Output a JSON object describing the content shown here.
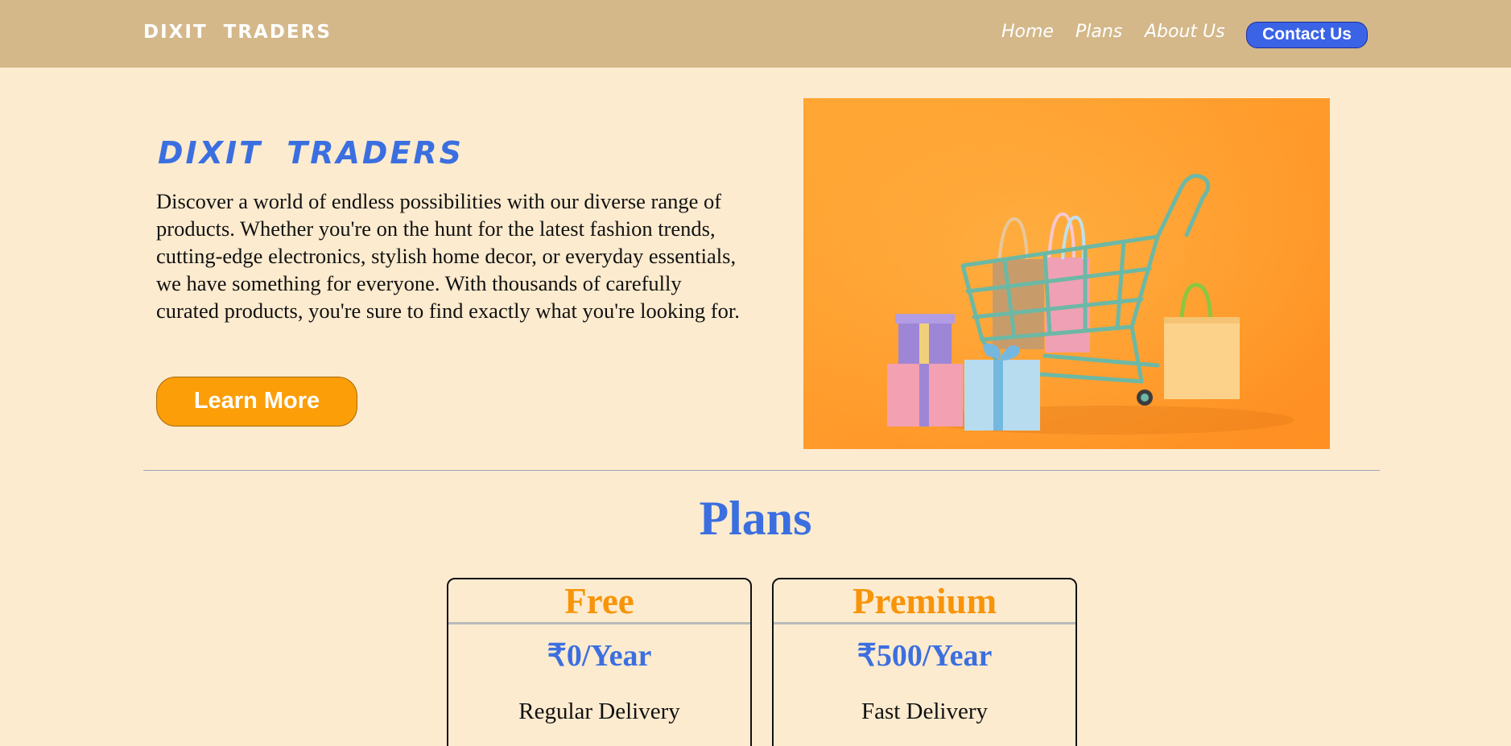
{
  "navbar": {
    "brand": "DIXIT TRADERS",
    "links": [
      "Home",
      "Plans",
      "About Us"
    ],
    "contact_label": "Contact Us"
  },
  "hero": {
    "title": "DIXIT TRADERS",
    "description": "Discover a world of endless possibilities with our diverse range of products. Whether you're on the hunt for the latest fashion trends, cutting-edge electronics, stylish home decor, or everyday essentials, we have something for everyone. With thousands of carefully curated products, you're sure to find exactly what you're looking for.",
    "button_label": "Learn More",
    "image_icon": "shopping-cart-gifts-image"
  },
  "plans": {
    "heading": "Plans",
    "cards": [
      {
        "name": "Free",
        "price": "₹0/Year",
        "feature": "Regular Delivery"
      },
      {
        "name": "Premium",
        "price": "₹500/Year",
        "feature": "Fast Delivery"
      }
    ]
  },
  "colors": {
    "page_bg": "#fdebcf",
    "navbar_bg": "#d4b88a",
    "accent_blue": "#3b6fe0",
    "accent_orange": "#fb9e08",
    "image_bg": "#ff9f2e"
  }
}
